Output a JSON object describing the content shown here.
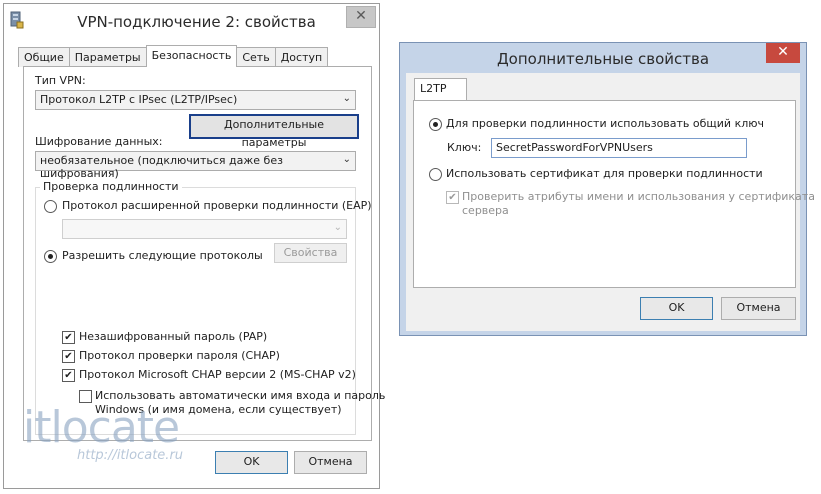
{
  "main_window": {
    "title": "VPN-подключение 2: свойства",
    "close": "✕",
    "tabs": [
      "Общие",
      "Параметры",
      "Безопасность",
      "Сеть",
      "Доступ"
    ],
    "vpn_type_label": "Тип VPN:",
    "vpn_type_value": "Протокол L2TP с IPsec (L2TP/IPsec)",
    "advanced_button": "Дополнительные параметры",
    "encryption_label": "Шифрование данных:",
    "encryption_value": "необязательное (подключиться даже без шифрования)",
    "auth_group_label": "Проверка подлинности",
    "eap_radio_label": "Протокол расширенной проверки подлинности (EAP)",
    "eap_combo_value": "",
    "allow_radio_label": "Разрешить следующие протоколы",
    "properties_button": "Свойства",
    "pap_label": "Незашифрованный пароль (PAP)",
    "chap_label": "Протокол проверки пароля (CHAP)",
    "mschap_label": "Протокол Microsoft CHAP версии 2 (MS-CHAP v2)",
    "auto_login_label_line1": "Использовать автоматически имя входа и пароль",
    "auto_login_label_line2": "Windows (и имя домена, если существует)",
    "ok_button": "OK",
    "cancel_button": "Отмена",
    "pap_checked": true,
    "chap_checked": true,
    "mschap_checked": true,
    "auto_login_checked": false
  },
  "advanced_window": {
    "title": "Дополнительные свойства",
    "close": "✕",
    "tab": "L2TP",
    "psk_radio_label": "Для проверки подлинности использовать общий ключ",
    "key_label": "Ключ:",
    "key_value": "SecretPasswordForVPNUsers",
    "cert_radio_label": "Использовать сертификат для проверки подлинности",
    "verify_label_line1": "Проверить атрибуты имени и использования у сертификата",
    "verify_label_line2": "сервера",
    "ok_button": "OK",
    "cancel_button": "Отмена"
  },
  "watermark": {
    "logo": "itlocate",
    "url": "http://itlocate.ru"
  },
  "icons": {
    "check": "✔",
    "dropdown": "⌄"
  },
  "colors": {
    "focus_border": "#1a3f8a",
    "dialog_frame": "#c5d4e8",
    "close_red": "#c7493e"
  }
}
